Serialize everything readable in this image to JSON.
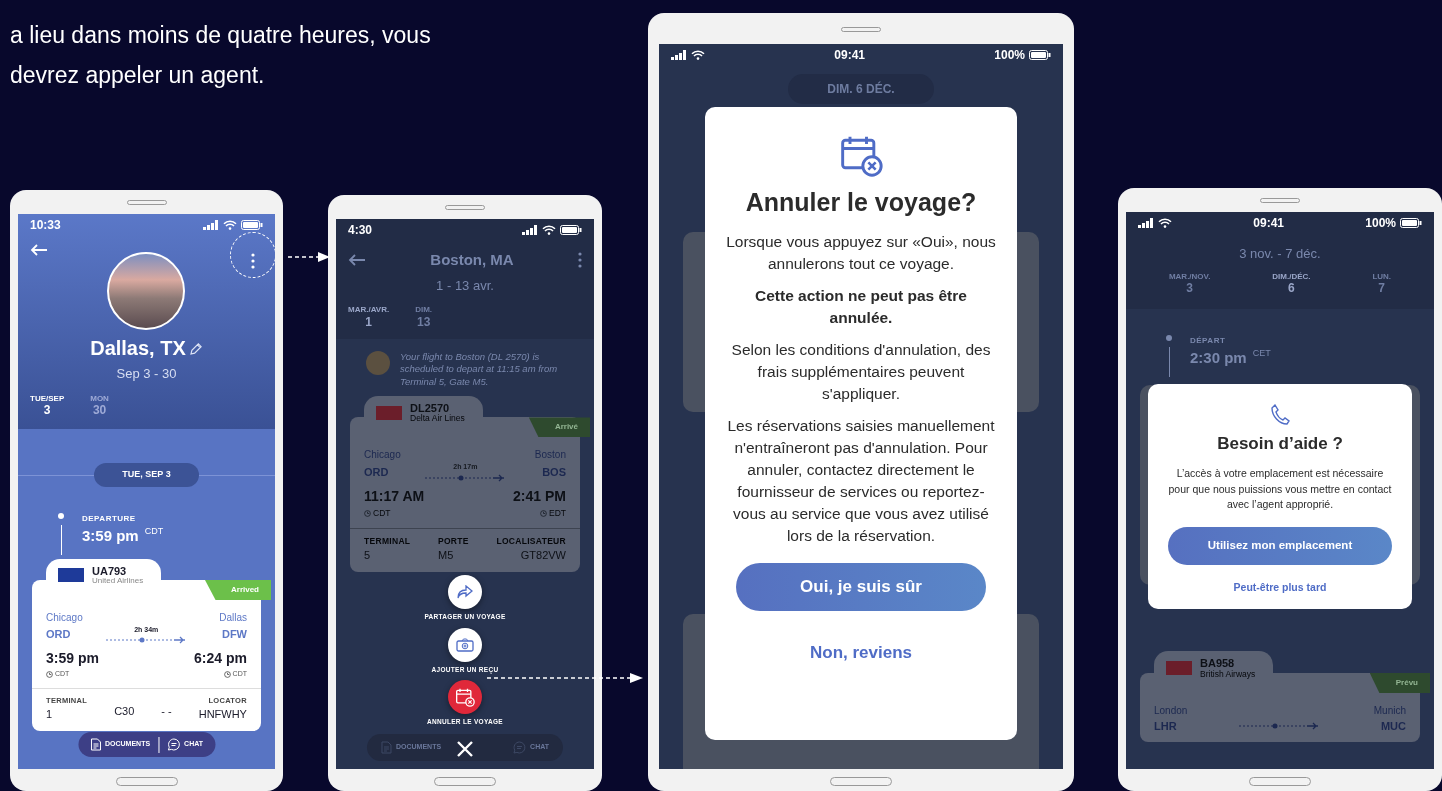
{
  "intro_lines": [
    "a lieu dans moins de quatre heures, vous",
    "devrez appeler un agent."
  ],
  "phones": [
    {
      "kind": "trip",
      "status": {
        "time": "10:33"
      },
      "title": "Dallas, TX",
      "dates": "Sep 3 - 30",
      "days": [
        {
          "label": "TUE/SEP",
          "number": "3",
          "selected": true
        },
        {
          "label": "MON",
          "number": "30",
          "selected": false
        }
      ],
      "date_pill": "TUE, SEP 3",
      "departure": {
        "label": "DEPARTURE",
        "time": "3:59 pm",
        "zone": "CDT"
      },
      "flight": {
        "code": "UA793",
        "airline": "United Airlines",
        "status": "Arrived",
        "from_city": "Chicago",
        "to_city": "Dallas",
        "duration": "2h 34m",
        "from_code": "ORD",
        "to_code": "DFW",
        "depart_time": "3:59 pm",
        "depart_zone": "CDT",
        "arrive_time": "6:24 pm",
        "arrive_zone": "CDT",
        "details": [
          {
            "label": "TERMINAL",
            "value": "1"
          },
          {
            "value": "C30"
          },
          {
            "value": "- -"
          },
          {
            "label": "LOCATOR",
            "value": "HNFWHY"
          }
        ]
      },
      "bottom_bar": [
        "DOCUMENTS",
        "CHAT"
      ]
    },
    {
      "kind": "menu",
      "status": {
        "time": "4:30"
      },
      "title": "Boston, MA",
      "dates": "1 - 13 avr.",
      "days": [
        {
          "label": "MAR./AVR.",
          "number": "1",
          "selected": true
        },
        {
          "label": "DIM.",
          "number": "13",
          "selected": false
        }
      ],
      "notice": "Your flight to Boston (DL 2570) is scheduled to depart at 11:15 am from Terminal 5, Gate M5.",
      "flight": {
        "code": "DL2570",
        "airline": "Delta Air Lines",
        "status": "Arrivé",
        "from_city": "Chicago",
        "to_city": "Boston",
        "duration": "2h 17m",
        "from_code": "ORD",
        "to_code": "BOS",
        "depart_time": "11:17 AM",
        "depart_zone": "CDT",
        "arrive_time": "2:41 PM",
        "arrive_zone": "EDT",
        "details": [
          {
            "label": "TERMINAL",
            "value": "5"
          },
          {
            "label": "PORTE",
            "value": "M5"
          },
          {
            "label": "LOCALISATEUR",
            "value": "GT82VW"
          }
        ]
      },
      "actions": [
        {
          "kind": "share",
          "label": "PARTAGER UN VOYAGE"
        },
        {
          "kind": "receipt",
          "label": "AJOUTER UN REÇU"
        },
        {
          "kind": "cancel",
          "label": "ANNULER LE VOYAGE"
        }
      ],
      "bottom_bar": [
        "DOCUMENTS",
        "CHAT"
      ]
    },
    {
      "kind": "cancel",
      "status": {
        "time": "09:41",
        "battery": "100%"
      },
      "date_pill": "DIM. 6 DÉC.",
      "dialog": {
        "title": "Annuler le voyage?",
        "paragraphs": [
          {
            "text": "Lorsque vous appuyez sur «Oui», nous annulerons tout ce voyage.",
            "bold": false
          },
          {
            "text": "Cette action ne peut pas être annulée.",
            "bold": true
          },
          {
            "text": "Selon les conditions d'annulation, des frais supplémentaires peuvent s'appliquer.",
            "bold": false
          },
          {
            "text": "Les réservations saisies manuellement n'entraîneront pas d'annulation. Pour annuler, contactez directement le fournisseur de services ou reportez-vous au service que vous avez utilisé lors de la réservation.",
            "bold": false
          }
        ],
        "confirm": "Oui, je suis sûr",
        "dismiss": "Non, reviens"
      }
    },
    {
      "kind": "help",
      "status": {
        "time": "09:41",
        "battery": "100%"
      },
      "dates": "3 nov. - 7 déc.",
      "days": [
        {
          "label": "MAR./NOV.",
          "number": "3",
          "selected": false
        },
        {
          "label": "DIM./DÉC.",
          "number": "6",
          "selected": true
        },
        {
          "label": "LUN.",
          "number": "7",
          "selected": false
        }
      ],
      "departure": {
        "label": "DÉPART",
        "time": "2:30 pm",
        "zone": "CET"
      },
      "flight": {
        "code": "BA958",
        "airline": "British Airways",
        "status": "Prévu",
        "from_city": "London",
        "to_city": "Munich",
        "from_code": "LHR",
        "to_code": "MUC"
      },
      "dialog": {
        "title": "Besoin d’aide ?",
        "text": "L’accès à votre emplacement est nécessaire pour que nous puissions vous mettre en contact avec l’agent approprié.",
        "confirm": "Utilisez mon emplacement",
        "dismiss": "Peut-être plus tard"
      }
    }
  ]
}
